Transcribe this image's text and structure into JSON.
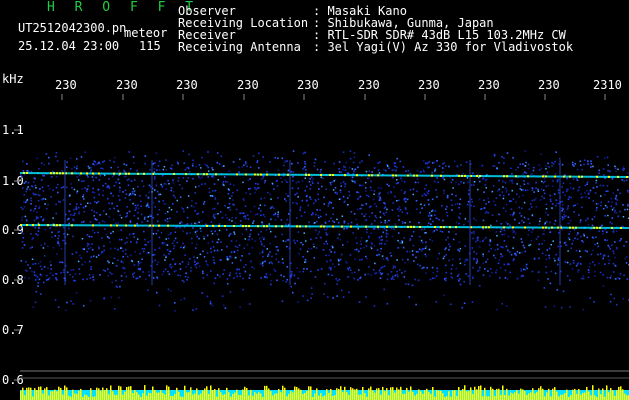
{
  "header": {
    "app_name": "H R O F F T",
    "filename": "UT2512042300.pn",
    "meteor_label": "meteor",
    "datetime": "25.12.04 23:00",
    "meteor_count": "115",
    "info_labels": [
      "Observer",
      "Receiving Location",
      "Receiver",
      "Receiving Antenna"
    ],
    "info_values": [
      ": Masaki Kano",
      ": Shibukawa, Gunma, Japan",
      ": RTL-SDR SDR# 43dB L15 103.2MHz CW",
      ": 3el Yagi(V) Az 330 for Vladivostok"
    ]
  },
  "axis": {
    "unit_label": "kHz",
    "time_ticks": [
      "230",
      "230",
      "230",
      "230",
      "230",
      "230",
      "230",
      "230",
      "230",
      "2310"
    ],
    "freq_ticks": [
      "1.1",
      "1.0",
      "0.9",
      "0.8",
      "0.7",
      "0.6"
    ]
  },
  "colors": {
    "background": "#000000",
    "header_green": "#22cc44",
    "noise_blue": "#1a2fd0",
    "signal_yellow": "#ffff00",
    "signal_cyan": "#00e0ff"
  }
}
